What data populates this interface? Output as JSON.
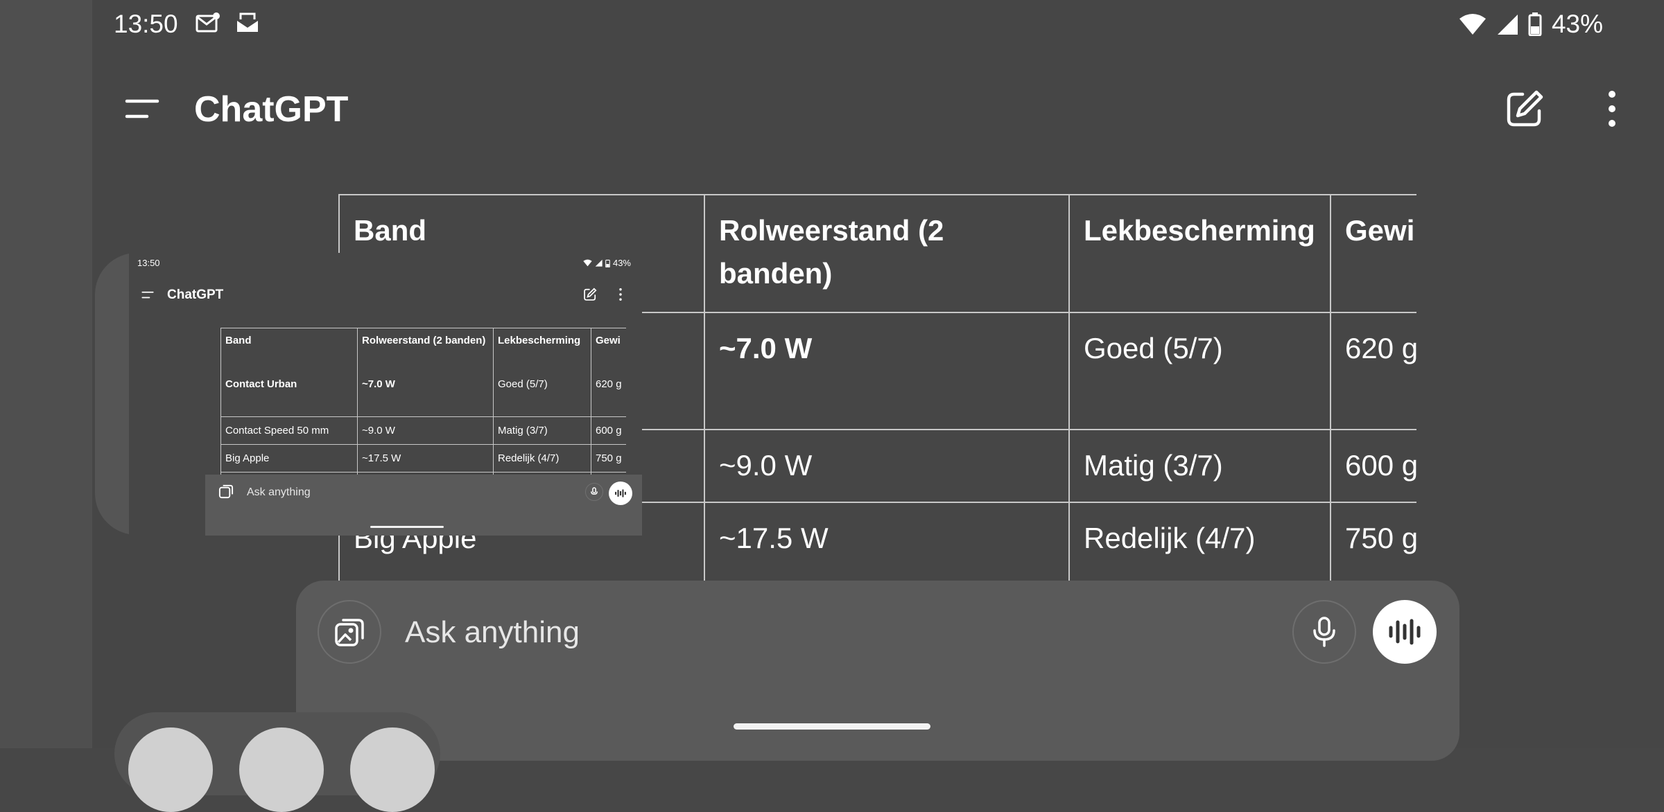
{
  "status_bar": {
    "time": "13:50",
    "battery": "43%",
    "icons": [
      "mail-icon",
      "inbox-icon",
      "wifi-icon",
      "signal-icon",
      "battery-icon"
    ]
  },
  "app_bar": {
    "title": "ChatGPT",
    "icons": [
      "menu-icon",
      "edit-icon",
      "more-vert-icon"
    ]
  },
  "table": {
    "headers": [
      "Band",
      "Rolweerstand (2 banden)",
      "Lekbescherming",
      "Gewi"
    ],
    "rows": [
      [
        "Contact Urban",
        "~7.0 W",
        "Goed (5/7)",
        "620 g"
      ],
      [
        "Contact Speed 50 mm",
        "~9.0 W",
        "Matig (3/7)",
        "600 g"
      ],
      [
        "Big Apple",
        "~17.5 W",
        "Redelijk (4/7)",
        "750 g"
      ]
    ]
  },
  "composer": {
    "placeholder": "Ask anything",
    "icons": [
      "image-attach-icon",
      "microphone-icon",
      "voice-waveform-icon"
    ]
  },
  "thumbnail": {
    "time": "13:50",
    "battery": "43%",
    "title": "ChatGPT",
    "headers": [
      "Band",
      "Rolweerstand (2 banden)",
      "Lekbescherming",
      "Gewi"
    ],
    "rows": [
      [
        "Contact Urban",
        "~7.0 W",
        "Goed (5/7)",
        "620 g"
      ],
      [
        "Contact Speed 50 mm",
        "~9.0 W",
        "Matig (3/7)",
        "600 g"
      ],
      [
        "Big Apple",
        "~17.5 W",
        "Redelijk (4/7)",
        "750 g"
      ]
    ],
    "placeholder": "Ask anything"
  },
  "colors": {
    "background": "#474747",
    "composer": "#5a5a5a",
    "text": "#ffffff",
    "divider": "#c8c8c8"
  }
}
